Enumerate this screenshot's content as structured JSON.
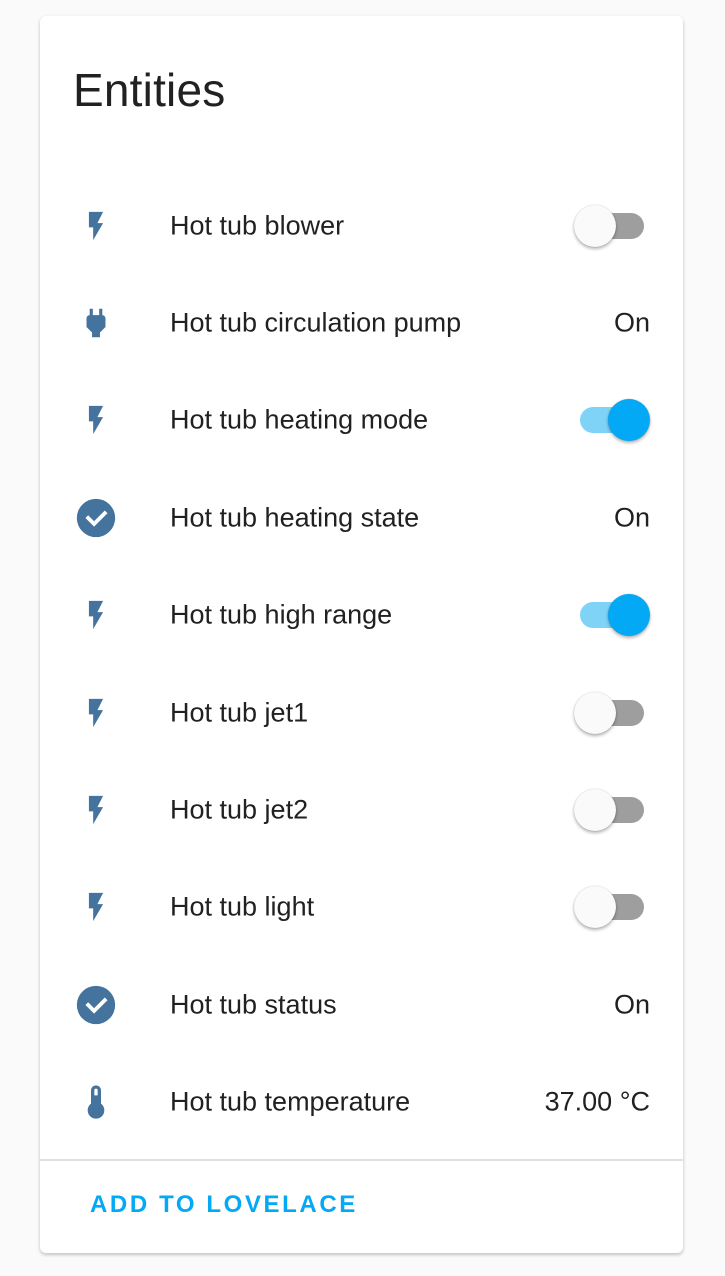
{
  "card": {
    "title": "Entities",
    "icon_color": "#44739e",
    "accent_color": "#03a9f4"
  },
  "entities": [
    {
      "name": "Hot tub blower",
      "icon": "flash-icon",
      "control": "toggle",
      "on": false
    },
    {
      "name": "Hot tub circulation pump",
      "icon": "power-plug-icon",
      "control": "state",
      "state": "On"
    },
    {
      "name": "Hot tub heating mode",
      "icon": "flash-icon",
      "control": "toggle",
      "on": true
    },
    {
      "name": "Hot tub heating state",
      "icon": "check-circle-icon",
      "control": "state",
      "state": "On"
    },
    {
      "name": "Hot tub high range",
      "icon": "flash-icon",
      "control": "toggle",
      "on": true
    },
    {
      "name": "Hot tub jet1",
      "icon": "flash-icon",
      "control": "toggle",
      "on": false
    },
    {
      "name": "Hot tub jet2",
      "icon": "flash-icon",
      "control": "toggle",
      "on": false
    },
    {
      "name": "Hot tub light",
      "icon": "flash-icon",
      "control": "toggle",
      "on": false
    },
    {
      "name": "Hot tub status",
      "icon": "check-circle-icon",
      "control": "state",
      "state": "On"
    },
    {
      "name": "Hot tub temperature",
      "icon": "thermometer-icon",
      "control": "state",
      "state": "37.00 °C"
    }
  ],
  "actions": {
    "add_label": "ADD TO LOVELACE"
  }
}
